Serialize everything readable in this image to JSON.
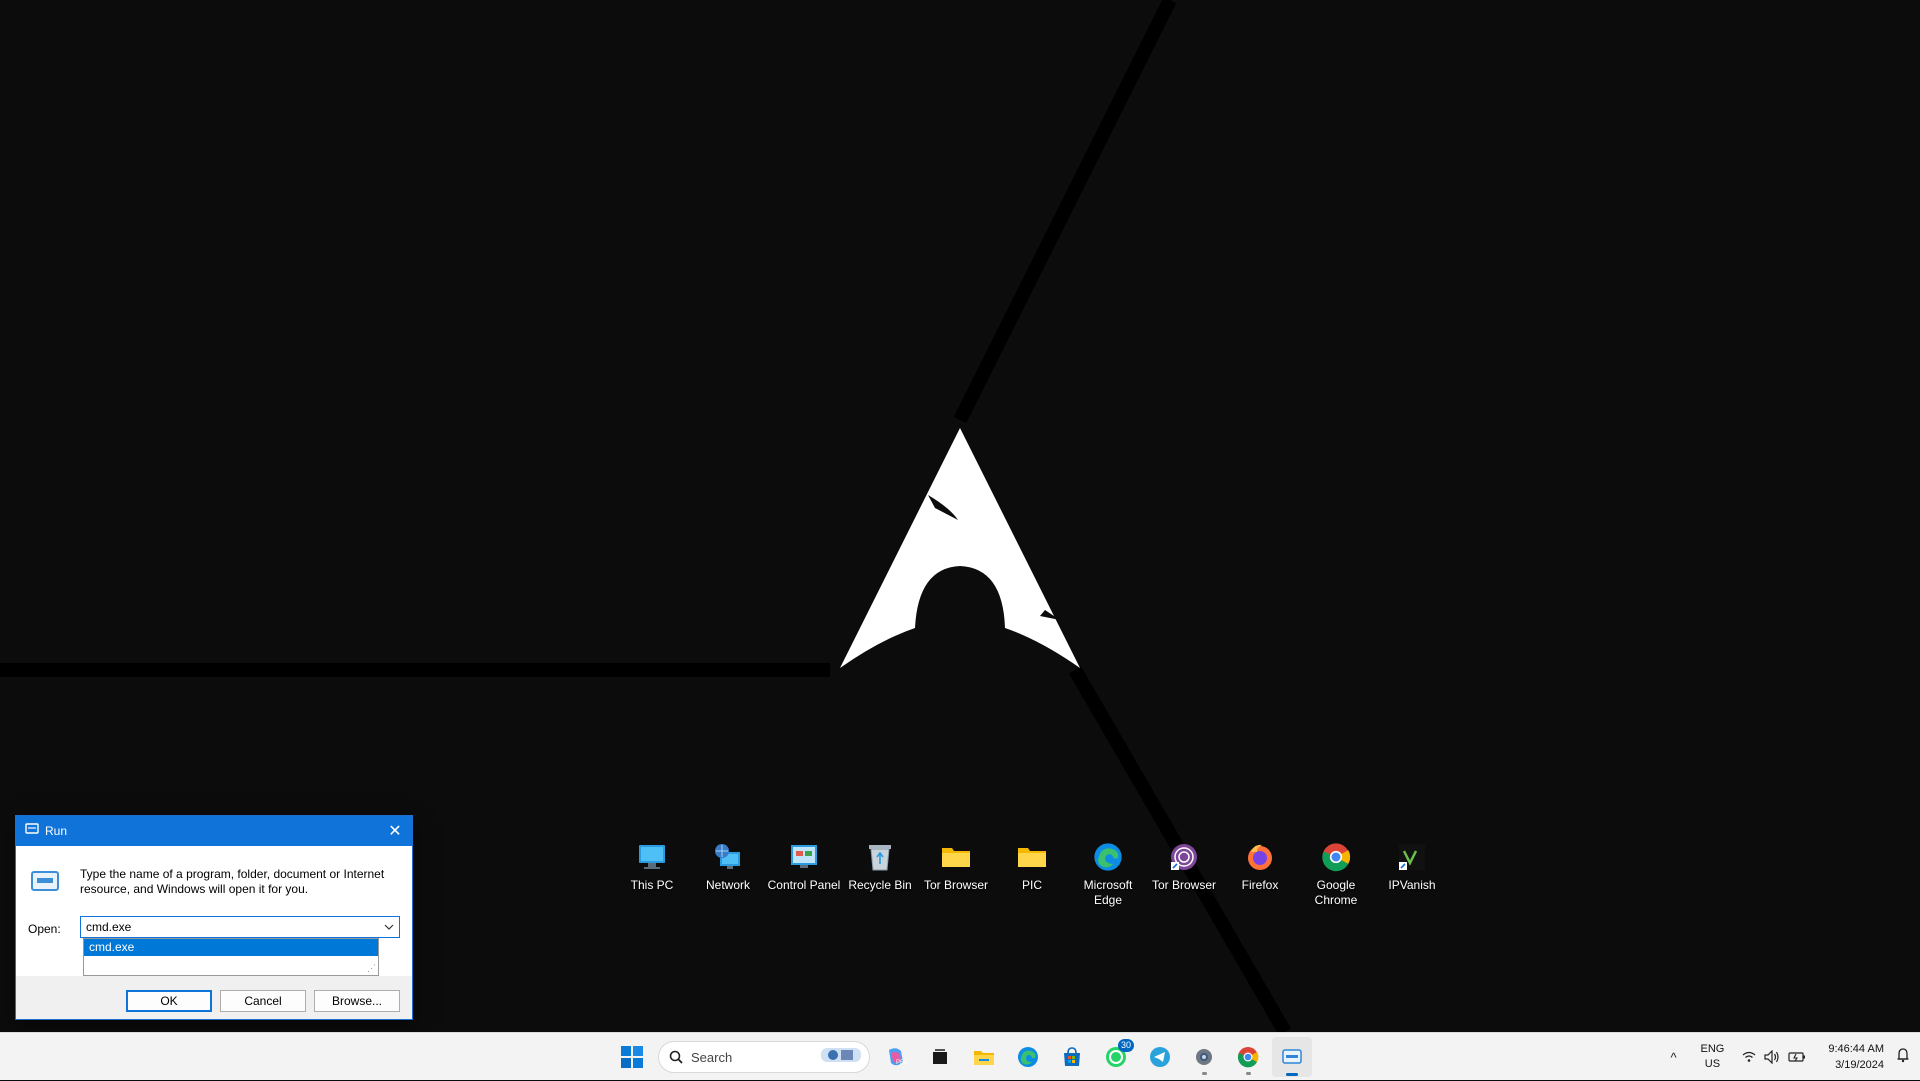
{
  "desktop": {
    "icons": [
      {
        "label": "This PC",
        "icon": "this-pc-icon"
      },
      {
        "label": "Network",
        "icon": "network-icon"
      },
      {
        "label": "Control Panel",
        "icon": "control-panel-icon"
      },
      {
        "label": "Recycle Bin",
        "icon": "recycle-bin-icon"
      },
      {
        "label": "Tor Browser",
        "icon": "folder-icon"
      },
      {
        "label": "PIC",
        "icon": "folder-icon"
      },
      {
        "label": "Microsoft Edge",
        "icon": "edge-icon"
      },
      {
        "label": "Tor Browser",
        "icon": "tor-browser-icon"
      },
      {
        "label": "Firefox",
        "icon": "firefox-icon"
      },
      {
        "label": "Google Chrome",
        "icon": "chrome-icon"
      },
      {
        "label": "IPVanish",
        "icon": "ipvanish-icon"
      }
    ]
  },
  "run_dialog": {
    "title": "Run",
    "description": "Type the name of a program, folder, document or Internet resource, and Windows will open it for you.",
    "open_label": "Open:",
    "open_value": "cmd.exe",
    "autocomplete_items": [
      "cmd.exe"
    ],
    "ok_label": "OK",
    "cancel_label": "Cancel",
    "browse_label": "Browse..."
  },
  "taskbar": {
    "search_placeholder": "Search",
    "whatsapp_badge": "30",
    "apps": [
      "start-icon",
      "search",
      "copilot-icon",
      "task-view-icon",
      "file-explorer-icon",
      "edge-icon",
      "microsoft-store-icon",
      "whatsapp-icon",
      "telegram-icon",
      "settings-icon",
      "chrome-icon",
      "run-icon"
    ],
    "tray": {
      "language_line1": "ENG",
      "language_line2": "US",
      "time": "9:46:44 AM",
      "date": "3/19/2024"
    }
  },
  "colors": {
    "accent": "#0f73d9",
    "desktop_bg": "#0c0c0c",
    "taskbar_bg": "#f3f3f3"
  }
}
